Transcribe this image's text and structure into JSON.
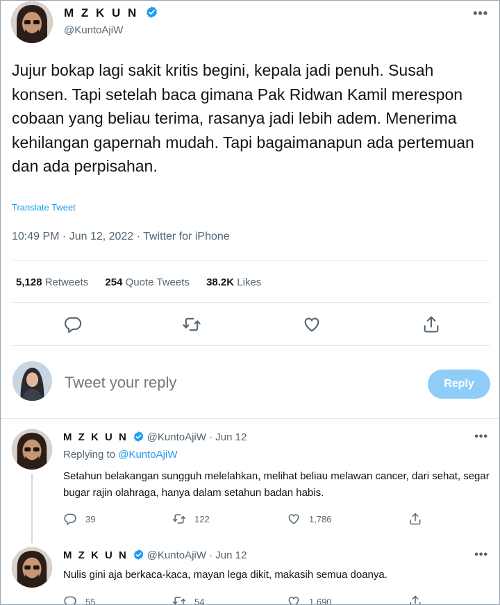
{
  "tweet": {
    "author_name": "M Z K U N",
    "author_handle": "@KuntoAjiW",
    "text": "Jujur bokap lagi sakit kritis begini, kepala jadi penuh. Susah konsen. Tapi setelah baca gimana Pak Ridwan Kamil merespon cobaan yang beliau terima, rasanya jadi lebih adem. Menerima kehilangan gapernah mudah. Tapi bagaimanapun ada pertemuan dan ada perpisahan.",
    "translate_label": "Translate Tweet",
    "meta": "10:49 PM · Jun 12, 2022 · Twitter for iPhone",
    "stats": {
      "retweets_count": "5,128",
      "retweets_label": "Retweets",
      "quotes_count": "254",
      "quotes_label": "Quote Tweets",
      "likes_count": "38.2K",
      "likes_label": "Likes"
    }
  },
  "compose": {
    "placeholder": "Tweet your reply",
    "button_label": "Reply"
  },
  "replies": [
    {
      "author_name": "M Z K U N",
      "handle_date": "@KuntoAjiW · Jun 12",
      "replying_prefix": "Replying to",
      "replying_to": "@KuntoAjiW",
      "text": "Setahun belakangan sungguh melelahkan, melihat beliau melawan cancer, dari sehat, segar bugar rajin olahraga, hanya dalam setahun badan habis.",
      "replies": "39",
      "retweets": "122",
      "likes": "1,786"
    },
    {
      "author_name": "M Z K U N",
      "handle_date": "@KuntoAjiW · Jun 12",
      "text": "Nulis gini aja berkaca-kaca, mayan lega dikit, makasih semua doanya.",
      "replies": "55",
      "retweets": "54",
      "likes": "1,690"
    }
  ],
  "icons": {
    "more": "more-icon",
    "reply": "reply-icon",
    "retweet": "retweet-icon",
    "like": "like-icon",
    "share": "share-icon",
    "verified": "verified-badge-icon"
  },
  "colors": {
    "accent": "#1d9bf0",
    "reply_button": "#8ecdf8",
    "secondary_text": "#536471",
    "divider": "#e4e9ec"
  }
}
